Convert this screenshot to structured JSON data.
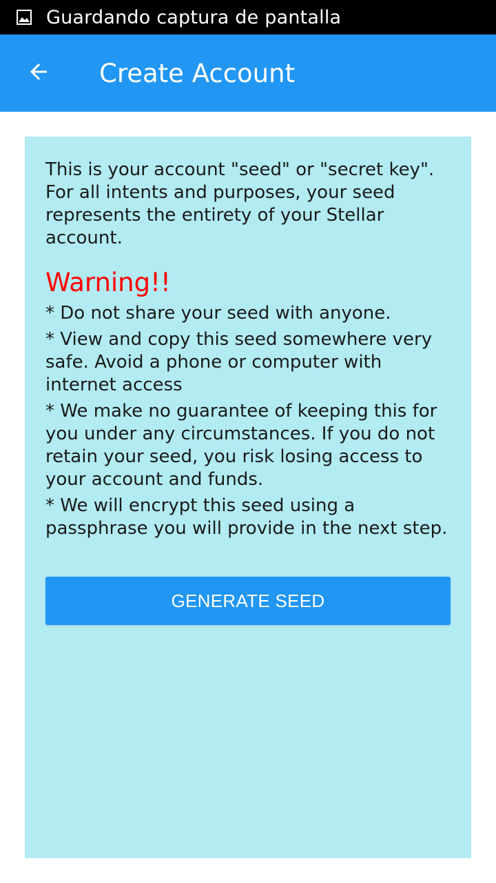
{
  "status_bar": {
    "icon": "image-icon",
    "text": "Guardando captura de pantalla"
  },
  "app_bar": {
    "back_icon": "arrow-left-icon",
    "title": "Create Account"
  },
  "content": {
    "intro": "This is your account \"seed\" or \"secret key\". For all intents and purposes, your seed represents the entirety of your Stellar account.",
    "warning_title": "Warning!!",
    "warnings": [
      "* Do not share your seed with anyone.",
      "* View and copy this seed somewhere very safe. Avoid a phone or computer with internet access",
      "* We make no guarantee of keeping this for you under any circumstances. If you do not retain your seed, you risk losing access to your account and funds.",
      "* We will encrypt this seed using a passphrase you will provide in the next step."
    ],
    "button_label": "GENERATE SEED"
  },
  "colors": {
    "status_bar": "#000000",
    "app_bar": "#2196f3",
    "card_background": "#b2ebf2",
    "warning": "#ff0000",
    "button": "#2196f3"
  }
}
